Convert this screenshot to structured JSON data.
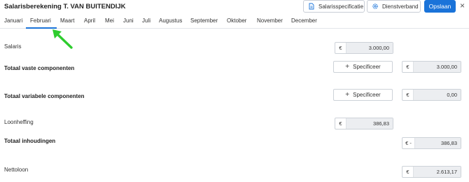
{
  "header": {
    "title": "Salarisberekening T. VAN BUITENDIJK",
    "salarisspecificatie_label": "Salarisspecificatie",
    "dienstverband_label": "Dienstverband",
    "save_label": "Opslaan",
    "close_glyph": "×"
  },
  "tabs": [
    "Januari",
    "Februari",
    "Maart",
    "April",
    "Mei",
    "Juni",
    "Juli",
    "Augustus",
    "September",
    "Oktober",
    "November",
    "December"
  ],
  "active_tab": "Februari",
  "rows": {
    "salaris": {
      "label": "Salaris",
      "currency": "€",
      "value": "3.000,00"
    },
    "totaal_vast": {
      "label": "Totaal vaste componenten",
      "specificeer": "Specificeer",
      "currency": "€",
      "value": "3.000,00"
    },
    "totaal_variabel": {
      "label": "Totaal variabele componenten",
      "specificeer": "Specificeer",
      "currency": "€",
      "value": "0,00"
    },
    "loonheffing": {
      "label": "Loonheffing",
      "currency": "€",
      "value": "386,83"
    },
    "totaal_inhoudingen": {
      "label": "Totaal inhoudingen",
      "currency": "€ -",
      "value": "386,83"
    },
    "nettoloon": {
      "label": "Nettoloon",
      "currency": "€",
      "value": "2.613,17"
    }
  },
  "plus_glyph": "+",
  "colors": {
    "accent": "#1a73d9",
    "annotation_arrow": "#2ecc2e"
  }
}
